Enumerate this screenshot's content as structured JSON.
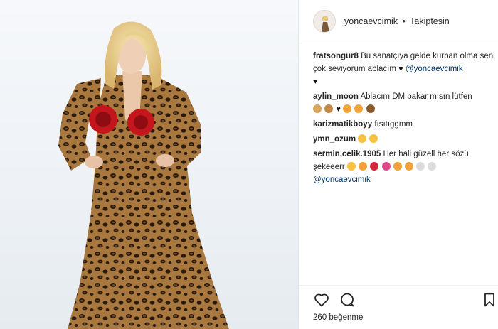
{
  "post": {
    "username": "yoncaevcimik",
    "separator": "•",
    "follow_label": "Takiptesin"
  },
  "comments": [
    {
      "user": "fratsongur8",
      "text": "Bu sanatçıya gelde kurban olma seni çok seviyorum ablacım",
      "mention": "@yoncaevcimik",
      "emojis": [
        "black-heart",
        "black-heart"
      ]
    },
    {
      "user": "aylin_moon",
      "text": "Ablacım DM bakar mısın lütfen",
      "emojis": [
        "people",
        "people",
        "black-heart",
        "cat-face",
        "cat-face",
        "paw"
      ]
    },
    {
      "user": "karizmatikboyy",
      "text": "fısıtıggmm",
      "emojis": []
    },
    {
      "user": "ymn_ozum",
      "text": "",
      "emojis": [
        "hugging-face",
        "hugging-face"
      ]
    },
    {
      "user": "sermin.celik.1905",
      "text": "Her hali güzell her sözü şekeeerr",
      "mention": "@yoncaevcimik",
      "emojis": [
        "grin",
        "heart-eyes",
        "lips",
        "bow",
        "cat-face",
        "cat-face",
        "ghost",
        "ghost"
      ]
    }
  ],
  "actions": {
    "like_icon": "heart-outline-icon",
    "comment_icon": "comment-bubble-icon",
    "save_icon": "bookmark-icon"
  },
  "likes": {
    "count": "260",
    "label": "beğenme"
  }
}
